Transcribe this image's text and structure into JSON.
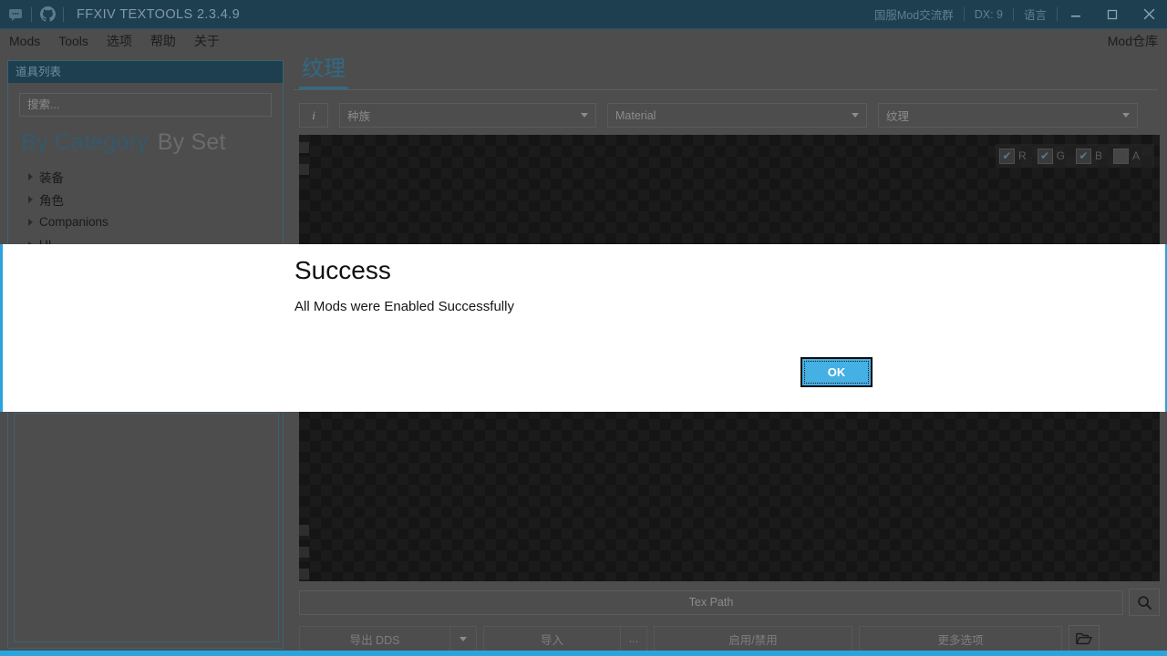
{
  "titlebar": {
    "app_title": "FFXIV TEXTOOLS 2.3.4.9",
    "discord_icon": "discord-icon",
    "github_icon": "github-icon",
    "links": [
      {
        "label": "国服Mod交流群"
      },
      {
        "label": "DX: 9"
      },
      {
        "label": "语言"
      }
    ],
    "minimize": "minimize-icon",
    "maximize": "maximize-icon",
    "close": "close-icon"
  },
  "menubar": {
    "items": [
      {
        "label": "Mods"
      },
      {
        "label": "Tools"
      },
      {
        "label": "选项"
      },
      {
        "label": "帮助"
      },
      {
        "label": "关于"
      }
    ],
    "right_label": "Mod仓库"
  },
  "sidebar": {
    "header": "道具列表",
    "search_placeholder": "搜索...",
    "tabs": [
      {
        "label": "By Category",
        "active": true
      },
      {
        "label": "By Set",
        "active": false
      }
    ],
    "tree": [
      {
        "label": "装备"
      },
      {
        "label": "角色"
      },
      {
        "label": "Companions"
      },
      {
        "label": "UI"
      }
    ]
  },
  "main": {
    "tab_label": "纹理",
    "info_button": "i",
    "filters": [
      {
        "name": "race-combo",
        "value": "种族"
      },
      {
        "name": "material-combo",
        "value": "Material"
      },
      {
        "name": "texture-combo",
        "value": "纹理"
      }
    ],
    "channels": [
      {
        "label": "R",
        "checked": true
      },
      {
        "label": "G",
        "checked": true
      },
      {
        "label": "B",
        "checked": true
      },
      {
        "label": "A",
        "checked": false
      }
    ],
    "tex_path_placeholder": "Tex Path",
    "search_icon": "search-icon",
    "folder_icon": "folder-open-icon",
    "actions": {
      "export_label": "导出  DDS",
      "import_label": "导入",
      "dots_label": "...",
      "enable_disable_label": "启用/禁用",
      "more_options_label": "更多选项"
    }
  },
  "dialog": {
    "title": "Success",
    "message": "All Mods were Enabled Successfully",
    "ok_label": "OK"
  },
  "colors": {
    "accent_blue": "#2ba3dc",
    "titlebar_bg": "#1e3f50",
    "window_bg": "#4d4d4d",
    "tab_active": "#2f6a86"
  }
}
